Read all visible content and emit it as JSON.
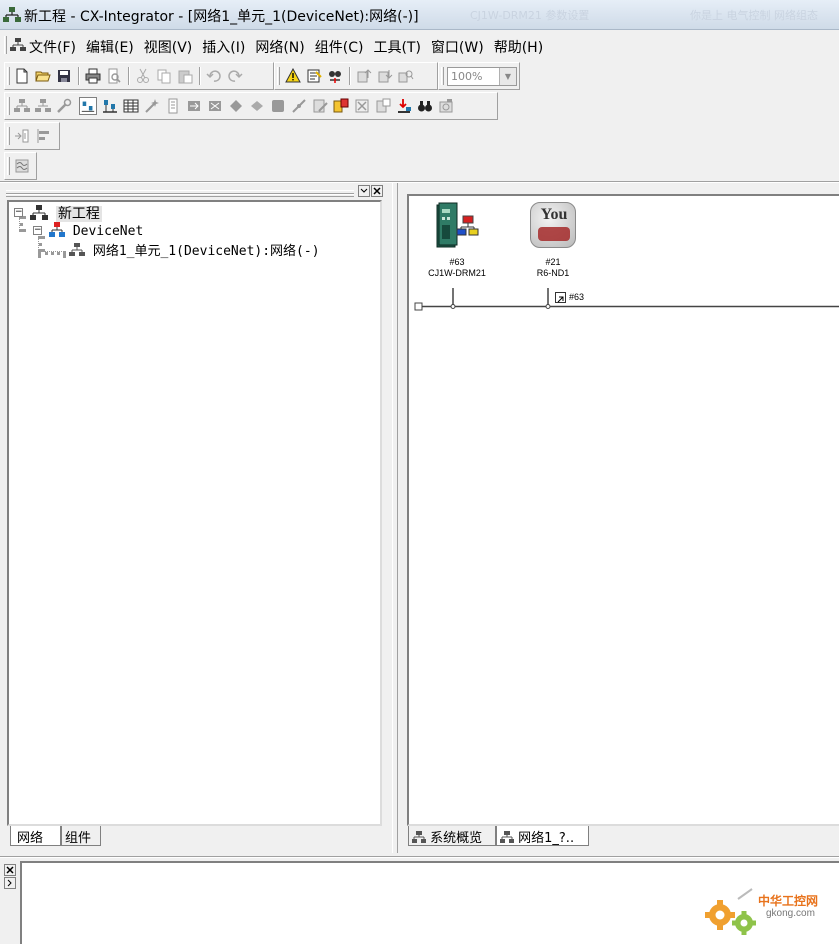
{
  "window": {
    "title": "新工程 - CX-Integrator - [网络1_单元_1(DeviceNet):网络(-)]",
    "background_tab_1": "CJ1W-DRM21 参数设置",
    "background_tab_2": "你是上 电气控制 网络组态"
  },
  "menu": {
    "items": [
      "文件(F)",
      "编辑(E)",
      "视图(V)",
      "插入(I)",
      "网络(N)",
      "组件(C)",
      "工具(T)",
      "窗口(W)",
      "帮助(H)"
    ]
  },
  "toolbar": {
    "zoom_value": "100%"
  },
  "tree": {
    "root_label": "新工程",
    "network_label": "DeviceNet",
    "unit_label": "网络1_单元_1(DeviceNet):网络(-)"
  },
  "left_tabs": {
    "network_tab": "网络",
    "component_tab": "组件"
  },
  "canvas": {
    "device1_node": "#63",
    "device1_model": "CJ1W-DRM21",
    "device2_node": "#21",
    "device2_model": "R6-ND1",
    "device2_icon_text": "You",
    "connector_label": "#63"
  },
  "right_tabs": {
    "overview_tab": "系统概览",
    "network_tab": "网络1_?.."
  },
  "watermark": {
    "name": "中华工控网",
    "url": "gkong.com"
  },
  "colors": {
    "canvas_bg": "#ffffff",
    "app_bg": "#f0f0f0",
    "watermark_orange": "#e8731c"
  }
}
